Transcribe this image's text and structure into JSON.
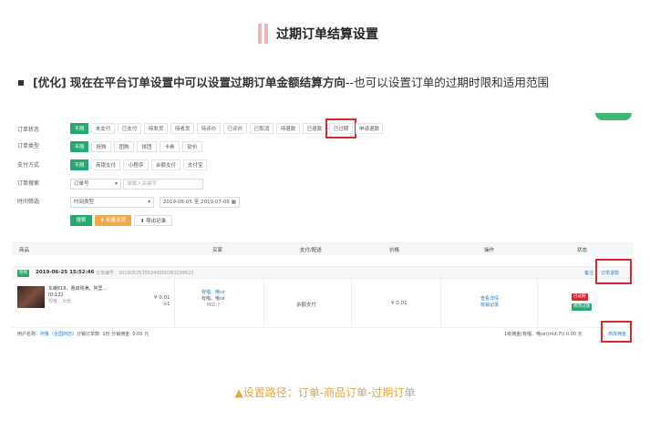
{
  "section_title": "过期订单结算设置",
  "note": {
    "tag": "[优化]",
    "bold_text": "现在在平台订单设置中可以设置过期订单金额结算方向",
    "rest_text": "--也可以设置订单的过期时限和适用范围"
  },
  "screenshot": {
    "filters": {
      "order_status": {
        "label": "订单状态",
        "options": [
          "不限",
          "未支付",
          "已支付",
          "待发货",
          "待收货",
          "待评价",
          "已评价",
          "已取消",
          "待退款",
          "已退款",
          "已过期",
          "申请退款"
        ],
        "active": "不限",
        "highlighted": "已过期"
      },
      "order_type": {
        "label": "订单类型",
        "options": [
          "不限",
          "抢购",
          "团购",
          "拼团",
          "卡券",
          "砍价"
        ],
        "active": "不限"
      },
      "pay_method": {
        "label": "支付方式",
        "options": [
          "不限",
          "商银支付",
          "小程序",
          "余额支付",
          "支付宝"
        ],
        "active": "不限"
      },
      "order_search": {
        "label": "订单搜索",
        "select_value": "订单号",
        "placeholder": "请输入关键字"
      },
      "time_filter": {
        "label": "时间筛选",
        "select_value": "时间类型",
        "date_range": "2019-06-05 至 2019-07-06"
      },
      "buttons": {
        "search": "搜索",
        "bulk_ship": "批量发货",
        "export": "导出记录"
      }
    },
    "table": {
      "headers": [
        "商品",
        "买家",
        "支付/配送",
        "价格",
        "操作",
        "状态"
      ],
      "order": {
        "tag": "抢购",
        "time": "2019-06-25 15:52:46",
        "order_no": "订单编号：20190525155240000283296622",
        "header_links": [
          "备注",
          "订单退款"
        ],
        "product_name": "东耀618，惠启购满，阿里...",
        "product_id": "ID:122",
        "product_spec": "规格：大份",
        "price": "¥ 0.01",
        "qty": "x1",
        "buyer_lines": [
          "有唱、哦sir",
          "有唱、哦sir"
        ],
        "buyer_mid": "MID:7",
        "pay_method": "余额支付",
        "total_price": "¥ 0.01",
        "ops": [
          "查看详情",
          "核销记录"
        ],
        "status_tags": [
          "已过期",
          "修改过期"
        ]
      },
      "footer": {
        "left_prefix": "用户名称：",
        "left_user": "阿鲁（",
        "left_user2": "全国商店",
        "left_rest": "）分销订单数: 1份 分销佣金: 0.00 元",
        "right_text": "1级佣金(有唱、哦sir(mid:7)) 0.00 元",
        "right_link": "修改佣金"
      }
    }
  },
  "caption": "▲设置路径：订单-商品订单-过期订单",
  "colors": {
    "green": "#26a872",
    "red_box": "#e0262b",
    "caption": "#e9a43a",
    "title_bar": "#f0b2b6"
  }
}
